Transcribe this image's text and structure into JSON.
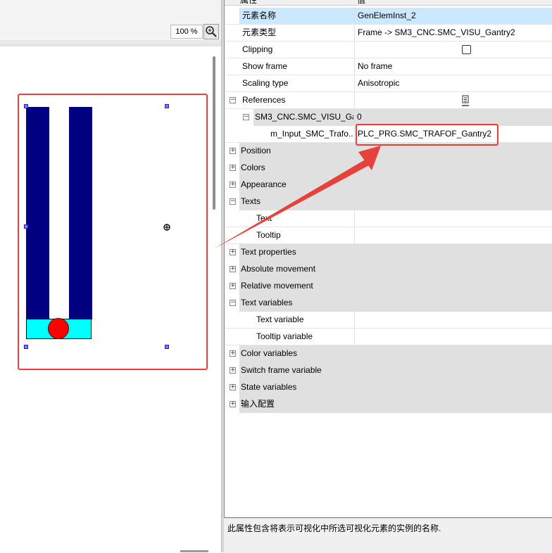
{
  "canvas": {
    "zoom": "100 %",
    "zoom_icon": "zoom-lens-icon"
  },
  "properties": {
    "columns": {
      "property": "属性",
      "value": "值"
    },
    "rows": [
      {
        "name": "元素名称",
        "value": "GenElemInst_2",
        "selected": true
      },
      {
        "name": "元素类型",
        "value": "Frame -> SM3_CNC.SMC_VISU_Gantry2"
      },
      {
        "name": "Clipping",
        "value": ""
      },
      {
        "name": "Show frame",
        "value": "No frame"
      },
      {
        "name": "Scaling type",
        "value": "Anisotropic"
      },
      {
        "name": "References",
        "value": ""
      },
      {
        "name": "SM3_CNC.SMC_VISU_Ga...",
        "value": "0"
      },
      {
        "name": "m_Input_SMC_Trafo...",
        "value": "PLC_PRG.SMC_TRAFOF_Gantry2"
      },
      {
        "name": "Position",
        "value": ""
      },
      {
        "name": "Colors",
        "value": ""
      },
      {
        "name": "Appearance",
        "value": ""
      },
      {
        "name": "Texts",
        "value": ""
      },
      {
        "name": "Text",
        "value": ""
      },
      {
        "name": "Tooltip",
        "value": ""
      },
      {
        "name": "Text properties",
        "value": ""
      },
      {
        "name": "Absolute movement",
        "value": ""
      },
      {
        "name": "Relative movement",
        "value": ""
      },
      {
        "name": "Text variables",
        "value": ""
      },
      {
        "name": "Text variable",
        "value": ""
      },
      {
        "name": "Tooltip variable",
        "value": ""
      },
      {
        "name": "Color variables",
        "value": ""
      },
      {
        "name": "Switch frame variable",
        "value": ""
      },
      {
        "name": "State variables",
        "value": ""
      },
      {
        "name": "输入配置",
        "value": ""
      }
    ],
    "clipping_checked": false,
    "reference_button_icon": "input-assistant-icon"
  },
  "status": {
    "description": "此属性包含将表示可视化中所选可视化元素的实例的名称."
  },
  "colors": {
    "bar": "#000080",
    "base": "#00ffff",
    "ball": "#ff0000",
    "annotation": "#e8403a",
    "selection": "#cce8ff",
    "category": "#e0e0e0"
  }
}
